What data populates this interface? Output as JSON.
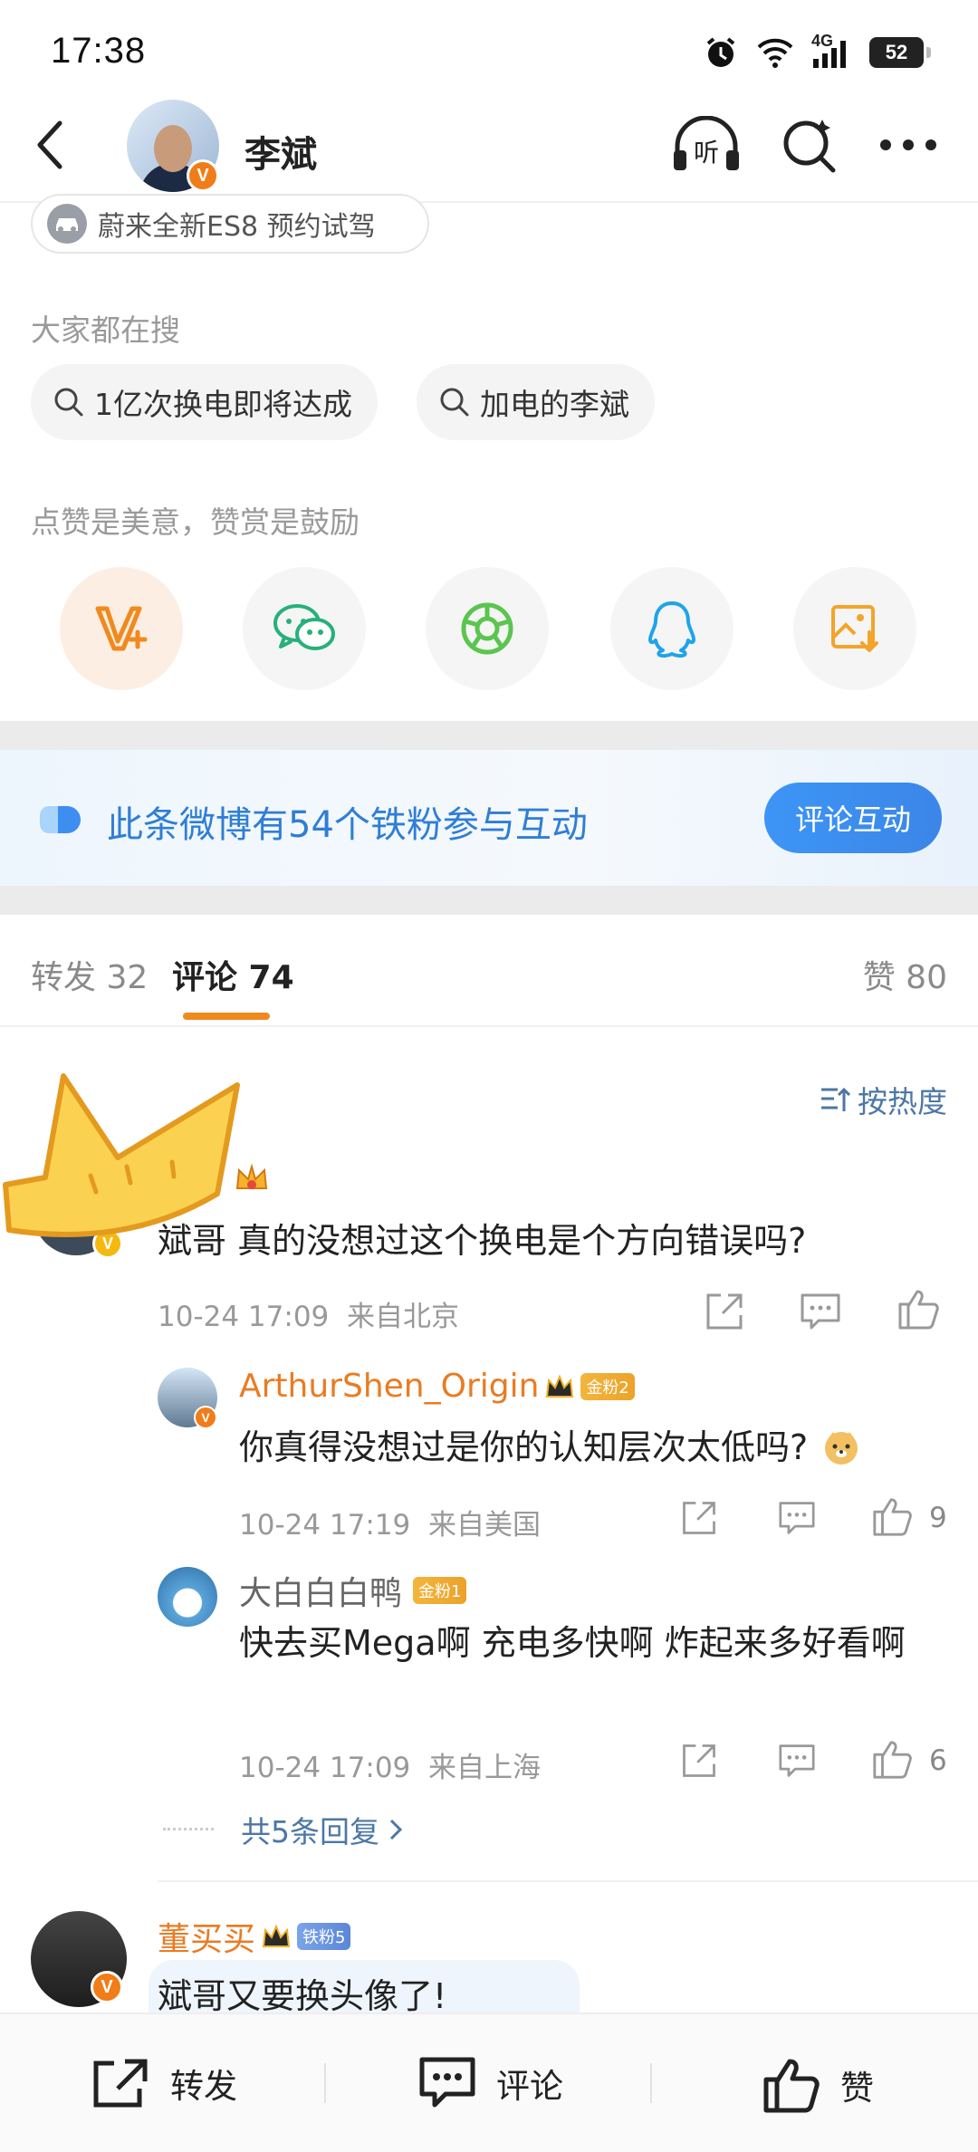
{
  "status_bar": {
    "time": "17:38",
    "network": "4G",
    "battery": "52"
  },
  "header": {
    "name": "李斌"
  },
  "ad": {
    "text": "蔚来全新ES8 预约试驾"
  },
  "trending": {
    "label": "大家都在搜",
    "chips": [
      "1亿次换电即将达成",
      "加电的李斌"
    ]
  },
  "reward": {
    "label": "点赞是美意，赞赏是鼓励"
  },
  "share_icons": [
    "v-plus-icon",
    "wechat-icon",
    "moments-icon",
    "qq-icon",
    "save-image-icon"
  ],
  "fans_banner": {
    "text": "此条微博有54个铁粉参与互动",
    "button": "评论互动"
  },
  "tabs": {
    "repost": "转发 32",
    "comment": "评论 74",
    "like": "赞 80"
  },
  "sort": {
    "label": "按热度"
  },
  "comments": [
    {
      "text": "斌哥 真的没想过这个换电是个方向错误吗?",
      "meta": "10-24 17:09  来自北京",
      "replies": [
        {
          "user": "ArthurShen_Origin",
          "badge": "金粉2",
          "text": "你真得没想过是你的认知层次太低吗?",
          "meta": "10-24 17:19  来自美国",
          "likes": "9"
        },
        {
          "user": "大白白白鸭",
          "badge": "金粉1",
          "text": "快去买Mega啊 充电多快啊 炸起来多好看啊",
          "meta": "10-24 17:09  来自上海",
          "likes": "6"
        }
      ],
      "more_replies": "共5条回复"
    },
    {
      "user": "董买买",
      "badge": "铁粉5",
      "text": "斌哥又要换头像了!"
    }
  ],
  "bottom_bar": {
    "repost": "转发",
    "comment": "评论",
    "like": "赞"
  },
  "colors": {
    "accent": "#f08a1e",
    "link": "#4c77a6",
    "username": "#ea7b22",
    "button_blue": "#3b86e8"
  }
}
